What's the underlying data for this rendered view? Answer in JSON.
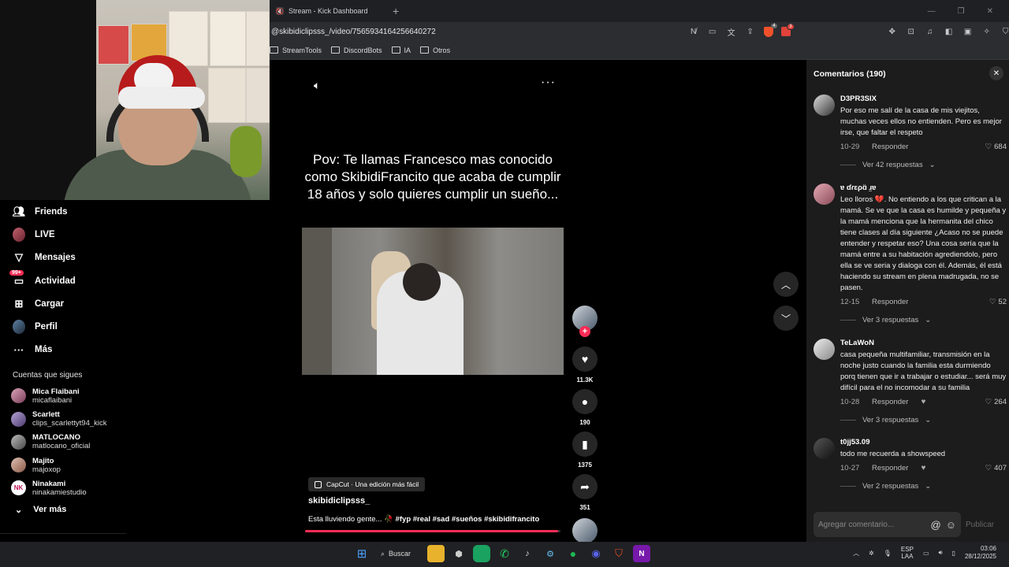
{
  "browser": {
    "tab_title": "Stream - Kick Dashboard",
    "new_tab": "+",
    "url": "@skibidiclipsss_/video/7565934164256640272",
    "shield_badge": "4",
    "ext_badge": "3",
    "bookmarks": [
      "StreamTools",
      "DiscordBots",
      "IA",
      "Otros"
    ]
  },
  "sidebar": {
    "nav": [
      {
        "label": "Friends",
        "icon": "friends-icon"
      },
      {
        "label": "LIVE",
        "icon": "live-icon"
      },
      {
        "label": "Mensajes",
        "icon": "messages-icon"
      },
      {
        "label": "Actividad",
        "icon": "activity-icon",
        "badge": "99+"
      },
      {
        "label": "Cargar",
        "icon": "upload-icon"
      },
      {
        "label": "Perfil",
        "icon": "profile-icon"
      },
      {
        "label": "Más",
        "icon": "more-icon"
      }
    ],
    "following_title": "Cuentas que sigues",
    "following": [
      {
        "name": "Mica Flaibani",
        "user": "micaflaibani"
      },
      {
        "name": "Scarlett",
        "user": "clips_scarlettyt94_kick"
      },
      {
        "name": "MATLOCANO",
        "user": "matlocano_oficial"
      },
      {
        "name": "Majito",
        "user": "majoxop"
      },
      {
        "name": "Ninakami",
        "user": "ninakamiestudio",
        "initials": "NK"
      }
    ],
    "see_more": "Ver más"
  },
  "video": {
    "caption": "Pov: Te llamas Francesco mas conocido como SkibidiFrancito que acaba de cumplir 18 años y solo quieres cumplir un sueño...",
    "capcut_label": "CapCut · Una edición más fácil",
    "author": "skibidiclipsss_",
    "description": "Esta lluviendo gente... 🥀",
    "hashtags": "#fyp #real #sad #sueños #skibidifrancito",
    "progress": 0.99,
    "likes": "11.3K",
    "comments": "190",
    "saves": "1375",
    "shares": "351",
    "follow_plus": "+"
  },
  "comments": {
    "title": "Comentarios (190)",
    "placeholder": "Agregar comentario...",
    "publish": "Publicar",
    "reply_label": "Responder",
    "items": [
      {
        "user": "D3PR3SIX",
        "text": "Por eso me salí de la casa de mis viejitos, muchas veces ellos no entienden. Pero es mejor irse, que faltar el respeto",
        "date": "10-29",
        "likes": "684",
        "replies": "Ver 42 respuestas"
      },
      {
        "user": "ɐ ɗɾɛρɑ̈ ɹ̤ɐ",
        "text": "Leo lloros 💔. No entiendo a los que critican a la mamá. Se ve que la casa es humilde y pequeña y la mamá menciona que la hermanita del chico tiene clases al día siguiente ¿Acaso no se puede entender y respetar eso? Una cosa sería que la mamá entre a su habitación agrediendolo, pero ella se ve seria y dialoga con él. Además, él está haciendo su stream en plena madrugada, no se pasen.",
        "date": "12-15",
        "likes": "52",
        "replies": "Ver 3 respuestas"
      },
      {
        "user": "TeLaWoN",
        "text": "casa pequeña multifamiliar, transmisión en la noche justo cuando la familia esta durmiendo porq tienen que ir a trabajar o estudiar... será muy difícil para el no incomodar a su familia",
        "date": "10-28",
        "likes": "264",
        "replies": "Ver 3 respuestas",
        "creator_liked": true
      },
      {
        "user": "t0jj53.09",
        "text": "todo me recuerda a showspeed",
        "date": "10-27",
        "likes": "407",
        "replies": "Ver 2 respuestas",
        "creator_liked": true
      }
    ]
  },
  "taskbar": {
    "search_label": "Buscar",
    "lang_top": "ESP",
    "lang_bottom": "LAA",
    "time": "03:06",
    "date": "28/12/2025"
  },
  "colors": {
    "accent": "#fe2c55",
    "panel": "#1c1c1c",
    "chrome": "#2b2d31"
  }
}
